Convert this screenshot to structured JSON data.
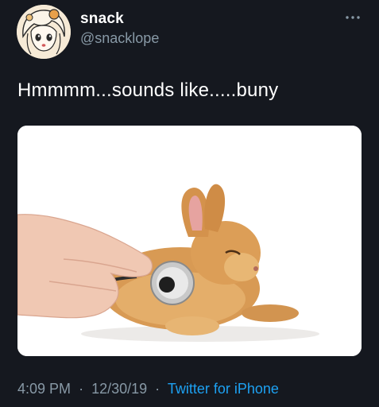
{
  "user": {
    "display_name": "snack",
    "handle": "@snacklope",
    "avatar_icon": "anime-avatar-icon"
  },
  "tweet": {
    "text": "Hmmmm...sounds like.....buny",
    "media_description": "bunny-stethoscope-photo",
    "time": "4:09 PM",
    "date": "12/30/19",
    "separator": "·",
    "source": "Twitter for iPhone"
  },
  "icons": {
    "more": "more-options-icon"
  },
  "colors": {
    "background": "#15181f",
    "text": "#ffffff",
    "secondary": "#8899a6",
    "link": "#1da1f2"
  }
}
